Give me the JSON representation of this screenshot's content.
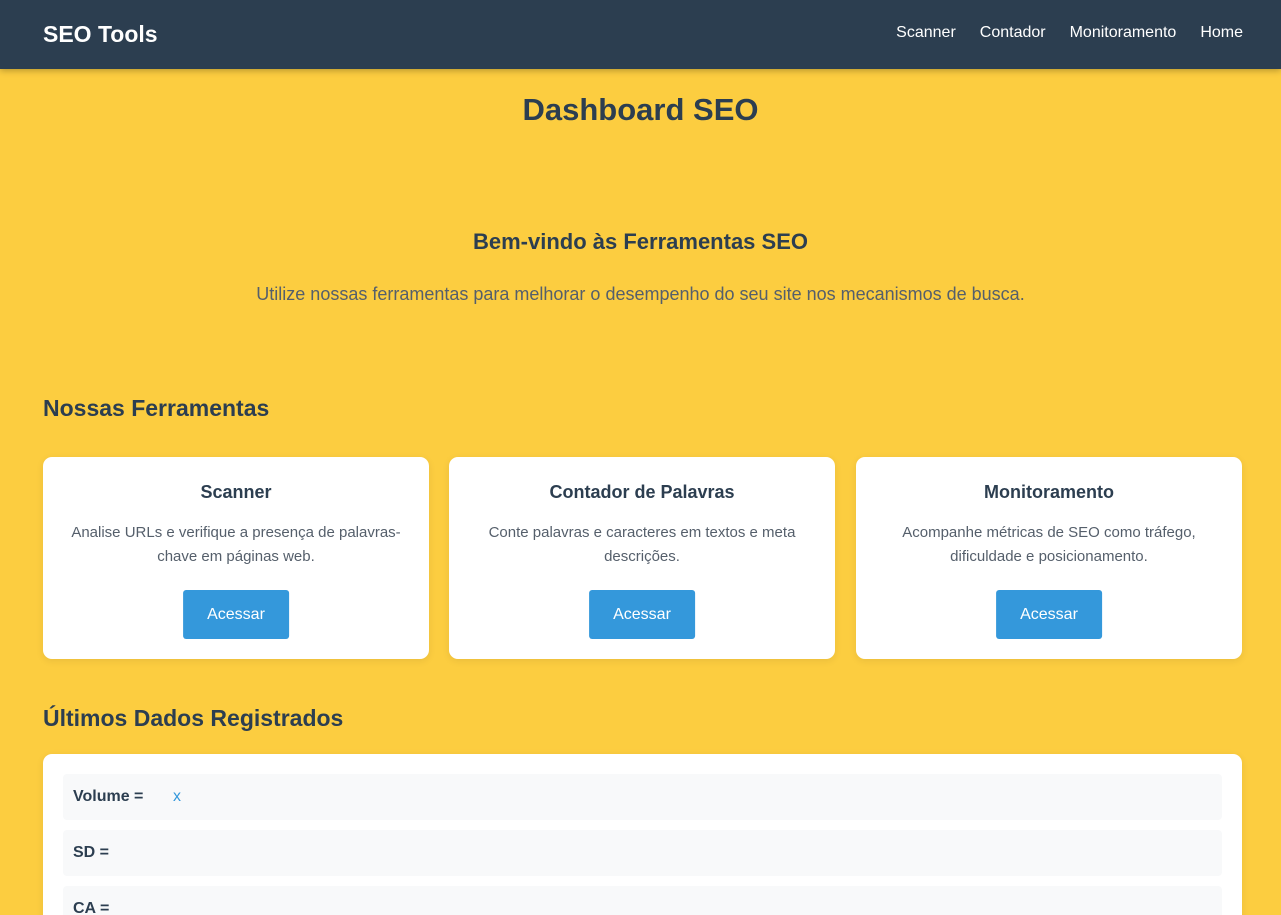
{
  "navbar": {
    "brand": "SEO Tools",
    "links": [
      "Scanner",
      "Contador",
      "Monitoramento",
      "Home"
    ]
  },
  "page": {
    "title": "Dashboard SEO"
  },
  "welcome": {
    "title": "Bem-vindo às Ferramentas SEO",
    "text": "Utilize nossas ferramentas para melhorar o desempenho do seu site nos mecanismos de busca."
  },
  "tools": {
    "section_title": "Nossas Ferramentas",
    "cards": [
      {
        "title": "Scanner",
        "description": "Analise URLs e verifique a presença de palavras-chave em páginas web.",
        "button": "Acessar"
      },
      {
        "title": "Contador de Palavras",
        "description": "Conte palavras e caracteres em textos e meta descrições.",
        "button": "Acessar"
      },
      {
        "title": "Monitoramento",
        "description": "Acompanhe métricas de SEO como tráfego, dificuldade e posicionamento.",
        "button": "Acessar"
      }
    ]
  },
  "latest_data": {
    "section_title": "Últimos Dados Registrados",
    "rows": [
      {
        "label": "Volume =",
        "value": "x"
      },
      {
        "label": "SD =",
        "value": ""
      },
      {
        "label": "CA =",
        "value": ""
      }
    ]
  },
  "colors": {
    "navbar": "#2c3e50",
    "background": "#fccd40",
    "accent": "#3498db",
    "card": "#ffffff",
    "row": "#f8f9fa"
  }
}
